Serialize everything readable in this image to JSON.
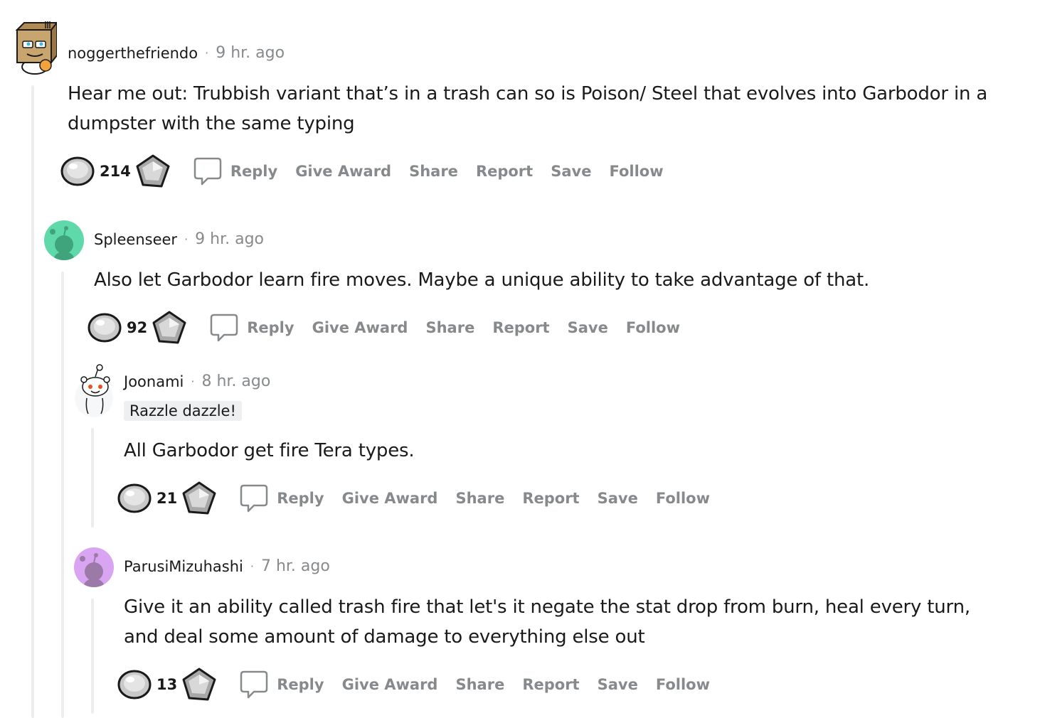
{
  "comments": [
    {
      "username": "noggerthefriendo",
      "time": "9 hr. ago",
      "flair": "",
      "body": "Hear me out: Trubbish variant that’s in a trash can so is Poison/ Steel that evolves into Garbodor in a dumpster with the same typing",
      "score": "214",
      "avatar_icon": "box-head-snoo-avatar"
    },
    {
      "username": "Spleenseer",
      "time": "9 hr. ago",
      "flair": "",
      "body": "Also let Garbodor learn fire moves. Maybe a unique ability to take advantage of that.",
      "score": "92",
      "avatar_color": "#5fd9a9",
      "avatar_icon": "default-snoo-avatar"
    },
    {
      "username": "Joonami",
      "time": "8 hr. ago",
      "flair": "Razzle dazzle!",
      "body": "All Garbodor get fire Tera types.",
      "score": "21",
      "avatar_icon": "snoo-avatar"
    },
    {
      "username": "ParusiMizuhashi",
      "time": "7 hr. ago",
      "flair": "",
      "body": "Give it an ability called trash fire that let's it negate the stat drop from burn, heal every turn, and deal some amount of damage to everything else out",
      "score": "13",
      "avatar_color": "#d9a4f2",
      "avatar_icon": "default-snoo-avatar"
    }
  ],
  "actions": {
    "reply": "Reply",
    "give_award": "Give Award",
    "share": "Share",
    "report": "Report",
    "save": "Save",
    "follow": "Follow"
  },
  "separator": "·"
}
